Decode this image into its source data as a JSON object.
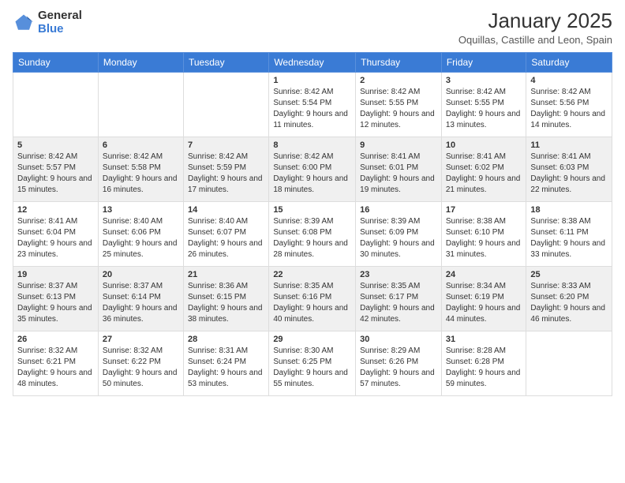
{
  "header": {
    "logo_general": "General",
    "logo_blue": "Blue",
    "month_year": "January 2025",
    "location": "Oquillas, Castille and Leon, Spain"
  },
  "weekdays": [
    "Sunday",
    "Monday",
    "Tuesday",
    "Wednesday",
    "Thursday",
    "Friday",
    "Saturday"
  ],
  "weeks": [
    [
      {
        "day": "",
        "sunrise": "",
        "sunset": "",
        "daylight": ""
      },
      {
        "day": "",
        "sunrise": "",
        "sunset": "",
        "daylight": ""
      },
      {
        "day": "",
        "sunrise": "",
        "sunset": "",
        "daylight": ""
      },
      {
        "day": "1",
        "sunrise": "Sunrise: 8:42 AM",
        "sunset": "Sunset: 5:54 PM",
        "daylight": "Daylight: 9 hours and 11 minutes."
      },
      {
        "day": "2",
        "sunrise": "Sunrise: 8:42 AM",
        "sunset": "Sunset: 5:55 PM",
        "daylight": "Daylight: 9 hours and 12 minutes."
      },
      {
        "day": "3",
        "sunrise": "Sunrise: 8:42 AM",
        "sunset": "Sunset: 5:55 PM",
        "daylight": "Daylight: 9 hours and 13 minutes."
      },
      {
        "day": "4",
        "sunrise": "Sunrise: 8:42 AM",
        "sunset": "Sunset: 5:56 PM",
        "daylight": "Daylight: 9 hours and 14 minutes."
      }
    ],
    [
      {
        "day": "5",
        "sunrise": "Sunrise: 8:42 AM",
        "sunset": "Sunset: 5:57 PM",
        "daylight": "Daylight: 9 hours and 15 minutes."
      },
      {
        "day": "6",
        "sunrise": "Sunrise: 8:42 AM",
        "sunset": "Sunset: 5:58 PM",
        "daylight": "Daylight: 9 hours and 16 minutes."
      },
      {
        "day": "7",
        "sunrise": "Sunrise: 8:42 AM",
        "sunset": "Sunset: 5:59 PM",
        "daylight": "Daylight: 9 hours and 17 minutes."
      },
      {
        "day": "8",
        "sunrise": "Sunrise: 8:42 AM",
        "sunset": "Sunset: 6:00 PM",
        "daylight": "Daylight: 9 hours and 18 minutes."
      },
      {
        "day": "9",
        "sunrise": "Sunrise: 8:41 AM",
        "sunset": "Sunset: 6:01 PM",
        "daylight": "Daylight: 9 hours and 19 minutes."
      },
      {
        "day": "10",
        "sunrise": "Sunrise: 8:41 AM",
        "sunset": "Sunset: 6:02 PM",
        "daylight": "Daylight: 9 hours and 21 minutes."
      },
      {
        "day": "11",
        "sunrise": "Sunrise: 8:41 AM",
        "sunset": "Sunset: 6:03 PM",
        "daylight": "Daylight: 9 hours and 22 minutes."
      }
    ],
    [
      {
        "day": "12",
        "sunrise": "Sunrise: 8:41 AM",
        "sunset": "Sunset: 6:04 PM",
        "daylight": "Daylight: 9 hours and 23 minutes."
      },
      {
        "day": "13",
        "sunrise": "Sunrise: 8:40 AM",
        "sunset": "Sunset: 6:06 PM",
        "daylight": "Daylight: 9 hours and 25 minutes."
      },
      {
        "day": "14",
        "sunrise": "Sunrise: 8:40 AM",
        "sunset": "Sunset: 6:07 PM",
        "daylight": "Daylight: 9 hours and 26 minutes."
      },
      {
        "day": "15",
        "sunrise": "Sunrise: 8:39 AM",
        "sunset": "Sunset: 6:08 PM",
        "daylight": "Daylight: 9 hours and 28 minutes."
      },
      {
        "day": "16",
        "sunrise": "Sunrise: 8:39 AM",
        "sunset": "Sunset: 6:09 PM",
        "daylight": "Daylight: 9 hours and 30 minutes."
      },
      {
        "day": "17",
        "sunrise": "Sunrise: 8:38 AM",
        "sunset": "Sunset: 6:10 PM",
        "daylight": "Daylight: 9 hours and 31 minutes."
      },
      {
        "day": "18",
        "sunrise": "Sunrise: 8:38 AM",
        "sunset": "Sunset: 6:11 PM",
        "daylight": "Daylight: 9 hours and 33 minutes."
      }
    ],
    [
      {
        "day": "19",
        "sunrise": "Sunrise: 8:37 AM",
        "sunset": "Sunset: 6:13 PM",
        "daylight": "Daylight: 9 hours and 35 minutes."
      },
      {
        "day": "20",
        "sunrise": "Sunrise: 8:37 AM",
        "sunset": "Sunset: 6:14 PM",
        "daylight": "Daylight: 9 hours and 36 minutes."
      },
      {
        "day": "21",
        "sunrise": "Sunrise: 8:36 AM",
        "sunset": "Sunset: 6:15 PM",
        "daylight": "Daylight: 9 hours and 38 minutes."
      },
      {
        "day": "22",
        "sunrise": "Sunrise: 8:35 AM",
        "sunset": "Sunset: 6:16 PM",
        "daylight": "Daylight: 9 hours and 40 minutes."
      },
      {
        "day": "23",
        "sunrise": "Sunrise: 8:35 AM",
        "sunset": "Sunset: 6:17 PM",
        "daylight": "Daylight: 9 hours and 42 minutes."
      },
      {
        "day": "24",
        "sunrise": "Sunrise: 8:34 AM",
        "sunset": "Sunset: 6:19 PM",
        "daylight": "Daylight: 9 hours and 44 minutes."
      },
      {
        "day": "25",
        "sunrise": "Sunrise: 8:33 AM",
        "sunset": "Sunset: 6:20 PM",
        "daylight": "Daylight: 9 hours and 46 minutes."
      }
    ],
    [
      {
        "day": "26",
        "sunrise": "Sunrise: 8:32 AM",
        "sunset": "Sunset: 6:21 PM",
        "daylight": "Daylight: 9 hours and 48 minutes."
      },
      {
        "day": "27",
        "sunrise": "Sunrise: 8:32 AM",
        "sunset": "Sunset: 6:22 PM",
        "daylight": "Daylight: 9 hours and 50 minutes."
      },
      {
        "day": "28",
        "sunrise": "Sunrise: 8:31 AM",
        "sunset": "Sunset: 6:24 PM",
        "daylight": "Daylight: 9 hours and 53 minutes."
      },
      {
        "day": "29",
        "sunrise": "Sunrise: 8:30 AM",
        "sunset": "Sunset: 6:25 PM",
        "daylight": "Daylight: 9 hours and 55 minutes."
      },
      {
        "day": "30",
        "sunrise": "Sunrise: 8:29 AM",
        "sunset": "Sunset: 6:26 PM",
        "daylight": "Daylight: 9 hours and 57 minutes."
      },
      {
        "day": "31",
        "sunrise": "Sunrise: 8:28 AM",
        "sunset": "Sunset: 6:28 PM",
        "daylight": "Daylight: 9 hours and 59 minutes."
      },
      {
        "day": "",
        "sunrise": "",
        "sunset": "",
        "daylight": ""
      }
    ]
  ]
}
